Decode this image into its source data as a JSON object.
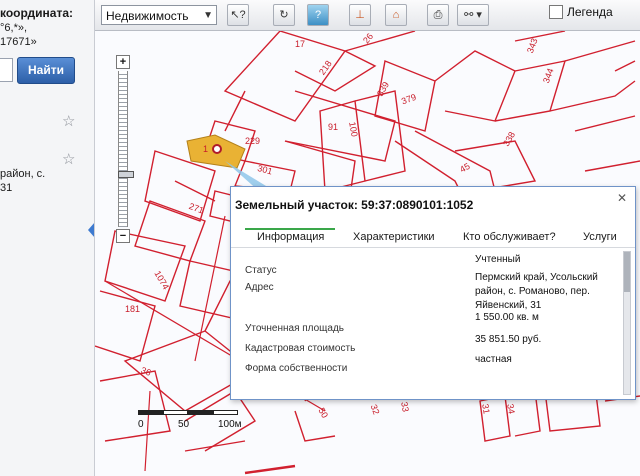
{
  "sidebar": {
    "line1": "координата:",
    "line2": "°6,*»,",
    "line3": "17671»",
    "find_button": "Найти",
    "result_line1": "район, с.",
    "result_line2": "31"
  },
  "toolbar": {
    "layer_select": "Недвижимость",
    "legend_label": "Легенда"
  },
  "map": {
    "lot_numbers": [
      "218",
      "229",
      "1",
      "301",
      "271",
      "1074",
      "181",
      "36",
      "91",
      "100",
      "339",
      "343",
      "344",
      "338",
      "45",
      "31",
      "32",
      "33",
      "34",
      "379",
      "26",
      "17",
      "50"
    ],
    "scale_labels": [
      "0",
      "50",
      "100м"
    ]
  },
  "popup": {
    "title": "Земельный участок: 59:37:0890101:1052",
    "tabs": [
      "Информация",
      "Характеристики",
      "Кто обслуживает?",
      "Услуги"
    ],
    "fields": [
      {
        "label": "Статус",
        "value": "Учтенный"
      },
      {
        "label": "Адрес",
        "value": "Пермский край, Усольский район, с. Романово, пер. Яйвенский, 31"
      },
      {
        "label": "Уточненная площадь",
        "value": "1 550.00 кв. м"
      },
      {
        "label": "Кадастровая стоимость",
        "value": "35 851.50 руб."
      },
      {
        "label": "Форма собственности",
        "value": "частная"
      }
    ]
  },
  "colors": {
    "parcel_line": "#d1202f",
    "selected_parcel": "#e9b234",
    "accent": "#3aa74a"
  }
}
